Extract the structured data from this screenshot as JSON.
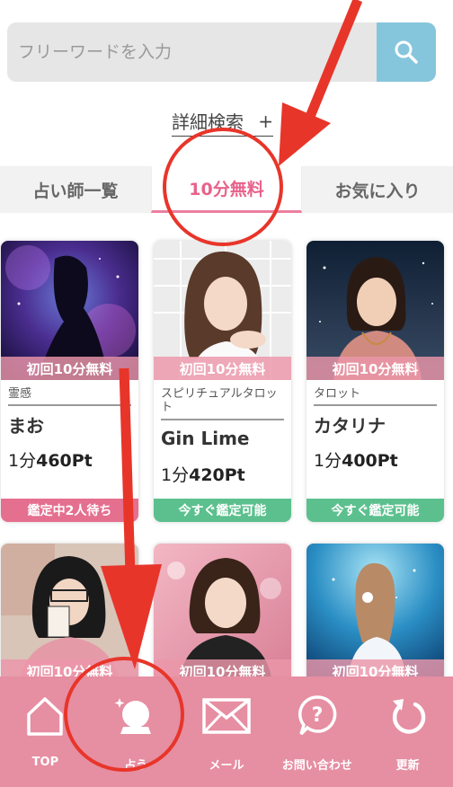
{
  "search": {
    "placeholder": "フリーワードを入力"
  },
  "advanced_search": {
    "label": "詳細検索",
    "plus": "+"
  },
  "tabs": [
    {
      "label": "占い師一覧"
    },
    {
      "label": "10分無料"
    },
    {
      "label": "お気に入り"
    }
  ],
  "cards": [
    {
      "badge": "初回10分無料",
      "genre": "霊感",
      "name": "まお",
      "price_prefix": "1分",
      "price_value": "460Pt",
      "status": "鑑定中2人待ち",
      "status_color": "#e56f8f"
    },
    {
      "badge": "初回10分無料",
      "genre": "スピリチュアルタロット",
      "name": "Gin Lime",
      "price_prefix": "1分",
      "price_value": "420Pt",
      "status": "今すぐ鑑定可能",
      "status_color": "#5cc08e"
    },
    {
      "badge": "初回10分無料",
      "genre": "タロット",
      "name": "カタリナ",
      "price_prefix": "1分",
      "price_value": "400Pt",
      "status": "今すぐ鑑定可能",
      "status_color": "#5cc08e"
    },
    {
      "badge": "初回10分無料"
    },
    {
      "badge": "初回10分無料"
    },
    {
      "badge": "初回10分無料"
    }
  ],
  "bottom_nav": [
    {
      "label": "TOP",
      "icon": "home-icon"
    },
    {
      "label": "占う",
      "icon": "crystal-ball-icon"
    },
    {
      "label": "メール",
      "icon": "mail-icon"
    },
    {
      "label": "お問い合わせ",
      "icon": "help-bubble-icon"
    },
    {
      "label": "更新",
      "icon": "refresh-icon"
    }
  ],
  "colors": {
    "accent_pink": "#e8628a",
    "nav_background": "#e68ea2",
    "search_button": "#86c6dc",
    "annotation_red": "#e8352a"
  }
}
